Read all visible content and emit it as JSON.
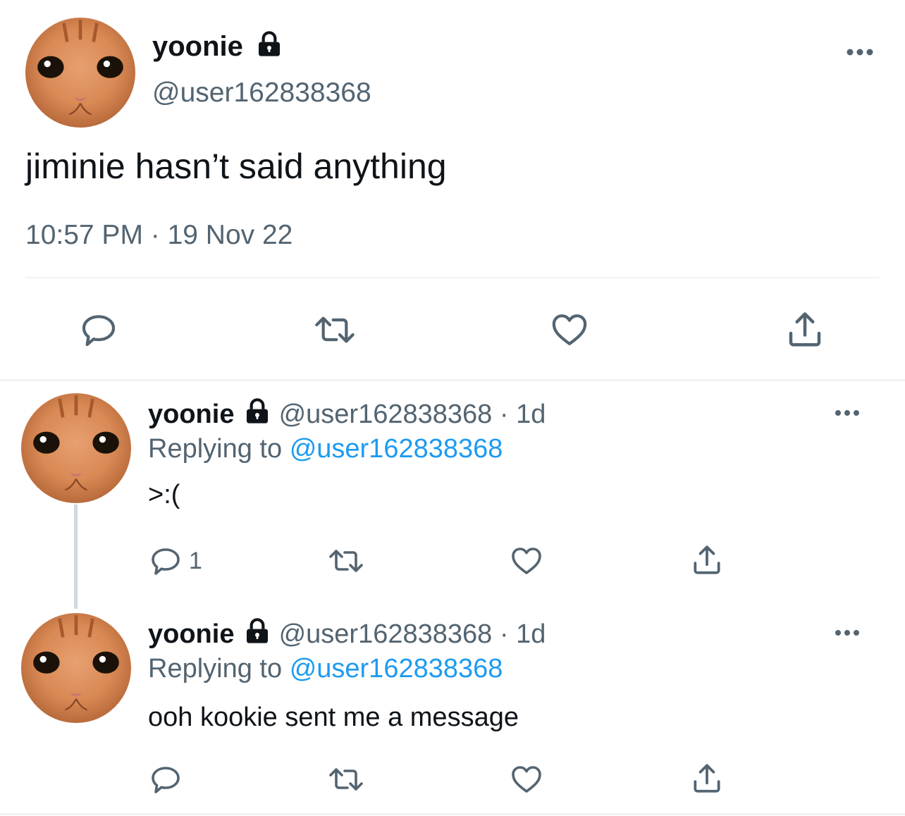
{
  "main_tweet": {
    "display_name": "yoonie",
    "handle": "@user162838368",
    "text": "jiminie hasn’t said anything",
    "timestamp": "10:57 PM · 19 Nov 22",
    "icons": [
      "more-icon",
      "lock-icon",
      "reply-icon",
      "retweet-icon",
      "like-icon",
      "share-icon"
    ]
  },
  "replies": [
    {
      "display_name": "yoonie",
      "handle": "@user162838368",
      "separator": "·",
      "age": "1d",
      "replying_prefix": "Replying to",
      "replying_to": "@user162838368",
      "text": ">:(",
      "reply_count": "1"
    },
    {
      "display_name": "yoonie",
      "handle": "@user162838368",
      "separator": "·",
      "age": "1d",
      "replying_prefix": "Replying to",
      "replying_to": "@user162838368",
      "text": "ooh kookie sent me a message",
      "reply_count": ""
    }
  ],
  "colors": {
    "text": "#0f1419",
    "muted": "#536471",
    "link": "#1d9bf0",
    "divider": "#eff3f4"
  }
}
